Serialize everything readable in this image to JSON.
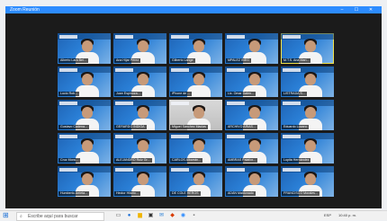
{
  "window": {
    "title": "Zoom Reunión",
    "controls": [
      "–",
      "☐",
      "✕"
    ]
  },
  "tiles": [
    [
      "Alberto Lara Bel...",
      "Ana Hijar Pérez",
      "Gilberto Lange",
      "MPALEZ INEG",
      "M.T.S. Ana Mari..."
    ],
    [
      "Lucio Rob...",
      "Juan Espinoza...",
      "iPhone de ...",
      "Lic. Omar Dalen...",
      "LISTRADA S..."
    ],
    [
      "Gustavo Cadena...",
      "GERARDO INDIGA",
      "Miguel Sánchez Macias",
      "ARCHIVO ARIAS...",
      "Eduardo Lozano"
    ],
    [
      "Cruz Mora...",
      "ALEJANDRO Ruiz Gr...",
      "CARLOS Albarrán...",
      "AMBRAS Palafox...",
      "Lupita Hernández"
    ],
    [
      "Humberto Arrieta...",
      "Hector Hilario...",
      "DE COLE HEROS",
      "ADÁN Maldonado",
      "FRANCISCO Morales..."
    ]
  ],
  "taskbar": {
    "start_icon": "windows-icon",
    "search_icon": "search-icon",
    "search_placeholder": "Escribe aquí para buscar",
    "language": "ESP",
    "time": "10:40 p. m.",
    "date": "19/08/2021"
  }
}
